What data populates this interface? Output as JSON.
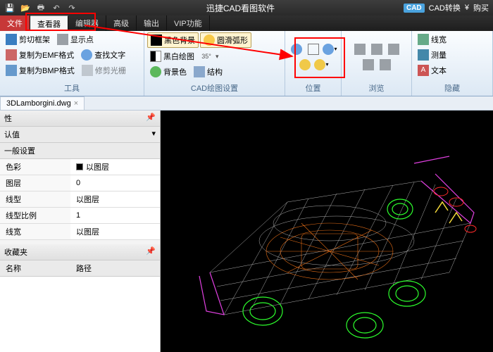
{
  "titlebar": {
    "app_title": "迅捷CAD看图软件",
    "cad_badge": "CAD",
    "cad_convert": "CAD转换",
    "buy": "购买"
  },
  "menubar": {
    "items": [
      "文件",
      "查看器",
      "编辑器",
      "高级",
      "输出",
      "VIP功能"
    ],
    "active_index": 1
  },
  "ribbon": {
    "groups": [
      {
        "label": "工具",
        "buttons": [
          {
            "icon": "cut",
            "label": "剪切框架"
          },
          {
            "icon": "emf",
            "label": "复制为EMF格式"
          },
          {
            "icon": "bmp",
            "label": "复制为BMP格式"
          },
          {
            "icon": "showpt",
            "label": "显示点"
          },
          {
            "icon": "findtxt",
            "label": "查找文字"
          },
          {
            "icon": "raster",
            "label": "修剪光栅"
          }
        ]
      },
      {
        "label": "CAD绘图设置",
        "buttons": [
          {
            "icon": "bg-black",
            "label": "黑色背景"
          },
          {
            "icon": "bg-bw",
            "label": "黑白绘图"
          },
          {
            "icon": "bg-color",
            "label": "背景色"
          },
          {
            "icon": "arc",
            "label": "圆滑弧形"
          },
          {
            "icon": "angle",
            "label": ""
          },
          {
            "icon": "struct",
            "label": "结构"
          }
        ]
      },
      {
        "label": "位置",
        "icons_only": true
      },
      {
        "label": "浏览",
        "icons_only": true
      },
      {
        "label": "隐藏",
        "buttons": [
          {
            "icon": "lw",
            "label": "线宽"
          },
          {
            "icon": "measure",
            "label": "测量"
          },
          {
            "icon": "text",
            "label": "文本"
          }
        ]
      }
    ]
  },
  "doc_tab": {
    "name": "3DLamborgini.dwg"
  },
  "props_panel": {
    "title": "性",
    "subtitle": "认值",
    "section": "一般设置",
    "rows": [
      {
        "k": "色彩",
        "v": "以图层",
        "swatch": true
      },
      {
        "k": "图层",
        "v": "0"
      },
      {
        "k": "线型",
        "v": "以图层"
      },
      {
        "k": "线型比例",
        "v": "1"
      },
      {
        "k": "线宽",
        "v": "以图层"
      }
    ],
    "fav_title": "收藏夹",
    "col1": "名称",
    "col2": "路径"
  },
  "colors": {
    "accent_red": "#f00",
    "annotation": "#ff0000"
  }
}
